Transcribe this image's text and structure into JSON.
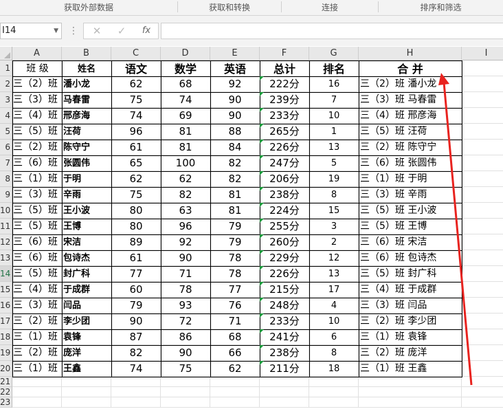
{
  "ribbon_groups": [
    "获取外部数据",
    "获取和转换",
    "连接",
    "排序和筛选"
  ],
  "name_box": "I14",
  "formula_bar": {
    "cancel": "✕",
    "enter": "✓",
    "fx": "fx",
    "content": ""
  },
  "columns": [
    "A",
    "B",
    "C",
    "D",
    "E",
    "F",
    "G",
    "H",
    "I"
  ],
  "row_numbers": [
    "1",
    "2",
    "3",
    "4",
    "5",
    "6",
    "7",
    "8",
    "9",
    "10",
    "11",
    "12",
    "13",
    "14",
    "15",
    "16",
    "17",
    "18",
    "19",
    "20",
    "21",
    "22",
    "23"
  ],
  "active_row": "14",
  "table": {
    "headers": {
      "class": "班 级",
      "name": "姓名",
      "chinese": "语文",
      "math": "数学",
      "english": "英语",
      "total": "总计",
      "rank": "排名",
      "merged": "合 并"
    },
    "rows": [
      {
        "class": "三（2）班",
        "name": "潘小龙",
        "chinese": "62",
        "math": "68",
        "english": "92",
        "total": "222分",
        "rank": "16",
        "merged": "三（2）班 潘小龙"
      },
      {
        "class": "三（3）班",
        "name": "马春雷",
        "chinese": "75",
        "math": "74",
        "english": "90",
        "total": "239分",
        "rank": "7",
        "merged": "三（3）班 马春雷"
      },
      {
        "class": "三（4）班",
        "name": "邢彦海",
        "chinese": "74",
        "math": "69",
        "english": "90",
        "total": "233分",
        "rank": "10",
        "merged": "三（4）班 邢彦海"
      },
      {
        "class": "三（5）班",
        "name": "汪荷",
        "chinese": "96",
        "math": "81",
        "english": "88",
        "total": "265分",
        "rank": "1",
        "merged": "三（5）班 汪荷"
      },
      {
        "class": "三（2）班",
        "name": "陈守宁",
        "chinese": "61",
        "math": "81",
        "english": "84",
        "total": "226分",
        "rank": "13",
        "merged": "三（2）班 陈守宁"
      },
      {
        "class": "三（6）班",
        "name": "张圆伟",
        "chinese": "65",
        "math": "100",
        "english": "82",
        "total": "247分",
        "rank": "5",
        "merged": "三（6）班 张圆伟"
      },
      {
        "class": "三（1）班",
        "name": "于明",
        "chinese": "62",
        "math": "62",
        "english": "82",
        "total": "206分",
        "rank": "19",
        "merged": "三（1）班 于明"
      },
      {
        "class": "三（3）班",
        "name": "辛雨",
        "chinese": "75",
        "math": "82",
        "english": "81",
        "total": "238分",
        "rank": "8",
        "merged": "三（3）班 辛雨"
      },
      {
        "class": "三（5）班",
        "name": "王小波",
        "chinese": "80",
        "math": "63",
        "english": "81",
        "total": "224分",
        "rank": "15",
        "merged": "三（5）班 王小波"
      },
      {
        "class": "三（5）班",
        "name": "王博",
        "chinese": "80",
        "math": "96",
        "english": "79",
        "total": "255分",
        "rank": "3",
        "merged": "三（5）班 王博"
      },
      {
        "class": "三（6）班",
        "name": "宋洁",
        "chinese": "89",
        "math": "92",
        "english": "79",
        "total": "260分",
        "rank": "2",
        "merged": "三（6）班 宋洁"
      },
      {
        "class": "三（6）班",
        "name": "包诗杰",
        "chinese": "61",
        "math": "90",
        "english": "78",
        "total": "229分",
        "rank": "12",
        "merged": "三（6）班 包诗杰"
      },
      {
        "class": "三（5）班",
        "name": "封广科",
        "chinese": "77",
        "math": "71",
        "english": "78",
        "total": "226分",
        "rank": "13",
        "merged": "三（5）班 封广科"
      },
      {
        "class": "三（4）班",
        "name": "于成群",
        "chinese": "60",
        "math": "78",
        "english": "77",
        "total": "215分",
        "rank": "17",
        "merged": "三（4）班 于成群"
      },
      {
        "class": "三（3）班",
        "name": "闫品",
        "chinese": "79",
        "math": "93",
        "english": "76",
        "total": "248分",
        "rank": "4",
        "merged": "三（3）班 闫品"
      },
      {
        "class": "三（2）班",
        "name": "李少团",
        "chinese": "90",
        "math": "72",
        "english": "71",
        "total": "233分",
        "rank": "10",
        "merged": "三（2）班 李少团"
      },
      {
        "class": "三（1）班",
        "name": "袁锋",
        "chinese": "87",
        "math": "86",
        "english": "68",
        "total": "241分",
        "rank": "6",
        "merged": "三（1）班 袁锋"
      },
      {
        "class": "三（2）班",
        "name": "庞洋",
        "chinese": "82",
        "math": "90",
        "english": "66",
        "total": "238分",
        "rank": "8",
        "merged": "三（2）班 庞洋"
      },
      {
        "class": "三（1）班",
        "name": "王鑫",
        "chinese": "74",
        "math": "75",
        "english": "62",
        "total": "211分",
        "rank": "18",
        "merged": "三（1）班 王鑫"
      }
    ]
  },
  "annotation_color": "#e8231f",
  "error_triangle_color": "#1a9a3a"
}
